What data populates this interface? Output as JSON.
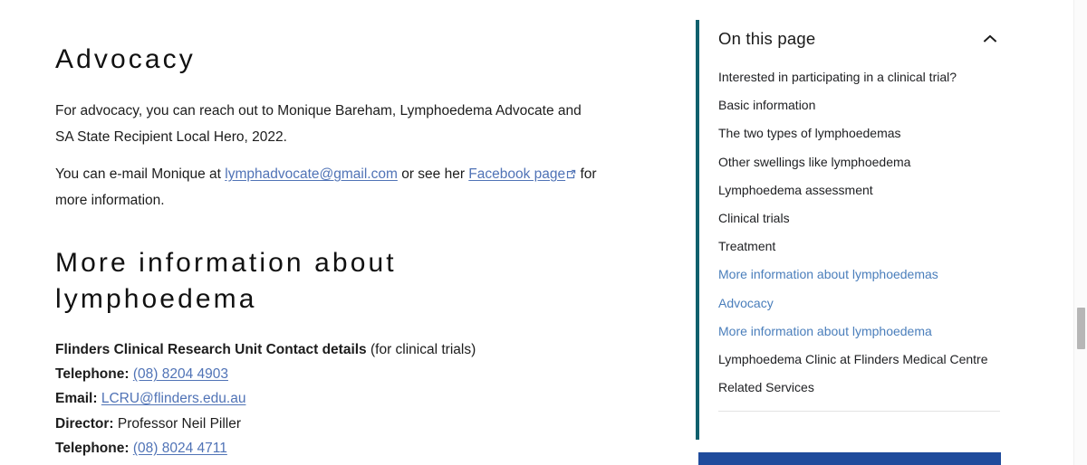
{
  "article": {
    "advocacy_heading": "Advocacy",
    "paragraph_1": "For advocacy, you can reach out to Monique Bareham, Lymphoedema Advocate and SA State Recipient Local Hero, 2022.",
    "paragraph_2": {
      "before_email": "You can e-mail Monique at ",
      "email_link": "lymphadvocate@gmail.com",
      "between": " or see her ",
      "facebook_link": "Facebook page",
      "external_icon": "external-link-icon",
      "after": " for more information."
    },
    "more_info_heading": "More information about lymphoedema",
    "contact": {
      "title_bold": "Flinders Clinical Research Unit Contact details",
      "title_rest": " (for clinical trials)",
      "rows": [
        {
          "label": "Telephone:",
          "value": "(08) 8204 4903",
          "is_link": true
        },
        {
          "label": "Email:",
          "value": "LCRU@flinders.edu.au",
          "is_link": true
        },
        {
          "label": "Director:",
          "value": "Professor Neil Piller",
          "is_link": false
        },
        {
          "label": "Telephone:",
          "value": "(08) 8024 4711",
          "is_link": true
        }
      ]
    }
  },
  "on_this_page": {
    "title": "On this page",
    "collapse_icon": "chevron-up-icon",
    "items": [
      {
        "label": "Interested in participating in a clinical trial?",
        "visited": false
      },
      {
        "label": "Basic information",
        "visited": false
      },
      {
        "label": "The two types of lymphoedemas",
        "visited": false
      },
      {
        "label": "Other swellings like lymphoedema",
        "visited": false
      },
      {
        "label": "Lymphoedema assessment",
        "visited": false
      },
      {
        "label": "Clinical trials",
        "visited": false
      },
      {
        "label": "Treatment",
        "visited": false
      },
      {
        "label": "More information about lymphoedemas",
        "visited": true
      },
      {
        "label": "Advocacy",
        "visited": true
      },
      {
        "label": "More information about lymphoedema",
        "visited": true
      },
      {
        "label": "Lymphoedema Clinic at Flinders Medical Centre",
        "visited": false
      },
      {
        "label": "Related Services",
        "visited": false
      }
    ]
  },
  "colors": {
    "rail_teal": "#10606d",
    "bottom_bar_blue": "#1f4b9c",
    "link_blue": "#5073b6",
    "visited_item_blue": "#4a7ebb",
    "body_text": "#1c1c1c",
    "divider": "#e3e3e3",
    "scrollbar_thumb": "#b6b6b6"
  },
  "scrollbar": {
    "name": "vertical-scrollbar"
  }
}
